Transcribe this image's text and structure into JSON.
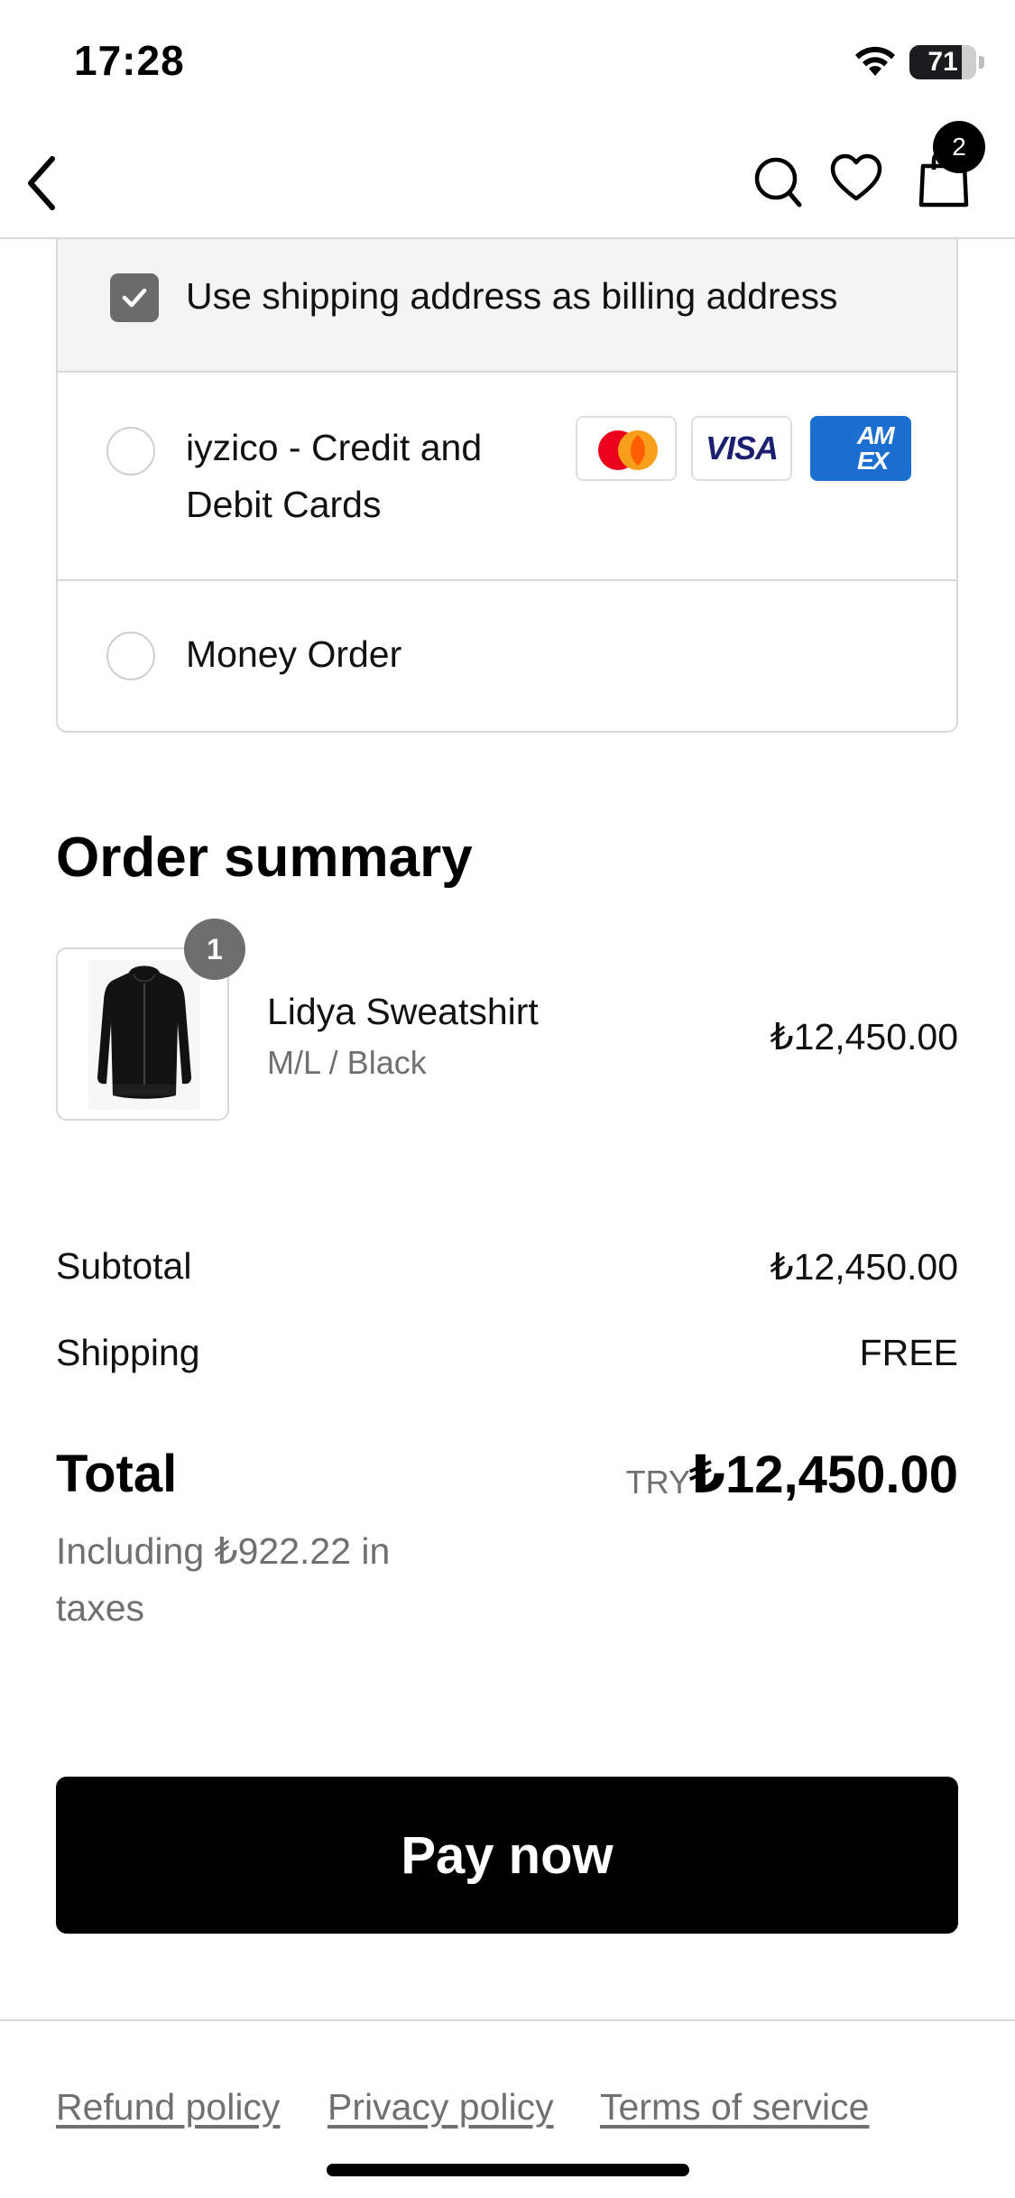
{
  "status_bar": {
    "time": "17:28",
    "battery_percent": "71"
  },
  "nav": {
    "cart_count": "2"
  },
  "payment": {
    "billing_same_label": "Use shipping address as billing address",
    "billing_same_checked": true,
    "options": [
      {
        "label": "iyzico - Credit and Debit Cards",
        "selected": false,
        "card_brands": [
          "Mastercard",
          "VISA",
          "AMEX"
        ]
      },
      {
        "label": "Money Order",
        "selected": false
      }
    ],
    "visa_text": "VISA",
    "amex_text_line1": "AM",
    "amex_text_line2": "EX"
  },
  "order_summary": {
    "title": "Order summary",
    "items": [
      {
        "quantity": "1",
        "name": "Lidya Sweatshirt",
        "variant": "M/L / Black",
        "price": "₺12,450.00"
      }
    ],
    "subtotal_label": "Subtotal",
    "subtotal_value": "₺12,450.00",
    "shipping_label": "Shipping",
    "shipping_value": "FREE",
    "total_label": "Total",
    "total_currency": "TRY",
    "total_value": "₺12,450.00",
    "tax_note": "Including ₺922.22 in taxes"
  },
  "actions": {
    "pay_now": "Pay now"
  },
  "footer": {
    "refund": "Refund policy",
    "privacy": "Privacy policy",
    "terms": "Terms of service"
  },
  "colors": {
    "primary": "#000000",
    "muted_text": "#707070",
    "border": "#d9d9d9",
    "billing_bg": "#f4f4f4"
  }
}
